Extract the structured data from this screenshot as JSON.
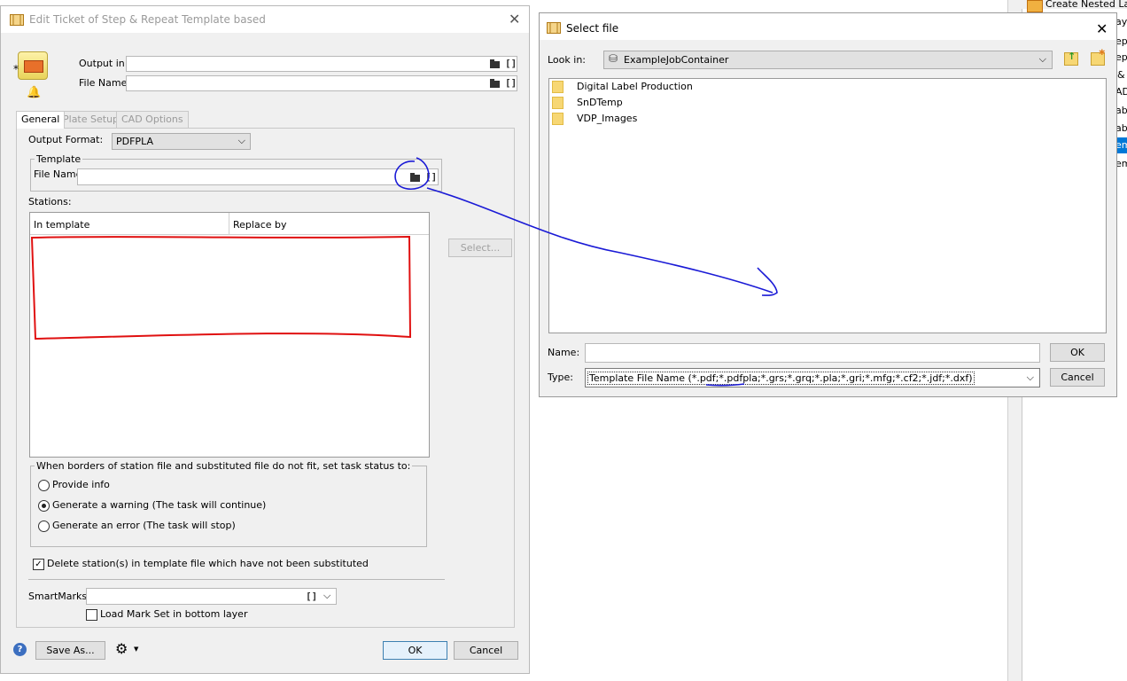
{
  "background_window": {
    "items": [
      "Create Nested Layo",
      "ayo",
      "epe",
      "epe",
      "&",
      "AD",
      "ab",
      "ab",
      "em",
      "em"
    ]
  },
  "edit_dialog": {
    "title": "Edit Ticket of Step & Repeat Template based",
    "output_in_label": "Output in:",
    "output_in_value": "",
    "file_name_label": "File Name:",
    "file_name_value": "",
    "tabs": [
      {
        "label": "General",
        "active": true
      },
      {
        "label": "Plate Setup",
        "active": false
      },
      {
        "label": "CAD Options",
        "active": false
      }
    ],
    "output_format_label": "Output Format:",
    "output_format_value": "PDFPLA",
    "template_group_label": "Template",
    "template_file_name_label": "File Name",
    "template_file_name_value": "",
    "stations_label": "Stations:",
    "stations_columns": [
      "In template",
      "Replace by"
    ],
    "select_button": "Select...",
    "status_group_label": "When borders of station file and substituted file do not fit, set task status to:",
    "status_options": [
      {
        "label": "Provide info",
        "selected": false
      },
      {
        "label": "Generate a warning (The task will continue)",
        "selected": true
      },
      {
        "label": "Generate an error (The task will stop)",
        "selected": false
      }
    ],
    "delete_stations_label": "Delete station(s) in template file which have not been substituted",
    "delete_stations_checked": true,
    "smartmarks_label": "SmartMarks:",
    "smartmarks_value": "",
    "load_markset_label": "Load Mark Set in bottom layer",
    "load_markset_checked": false,
    "save_as_button": "Save As...",
    "ok_button": "OK",
    "cancel_button": "Cancel"
  },
  "select_file_dialog": {
    "title": "Select file",
    "look_in_label": "Look in:",
    "look_in_value": "ExampleJobContainer",
    "folders": [
      "Digital Label Production",
      "SnDTemp",
      "VDP_Images"
    ],
    "name_label": "Name:",
    "name_value": "",
    "type_label": "Type:",
    "type_value": "Template File Name (*.pdf;*.pdfpla;*.grs;*.grq;*.pla;*.gri;*.mfg;*.cf2;*.jdf;*.dxf)",
    "ok_button": "OK",
    "cancel_button": "Cancel"
  },
  "colors": {
    "annotation_blue": "#1a1ad6",
    "annotation_red": "#e01010",
    "folder_yellow": "#f7d774",
    "default_button_border": "#3c7fb1"
  }
}
